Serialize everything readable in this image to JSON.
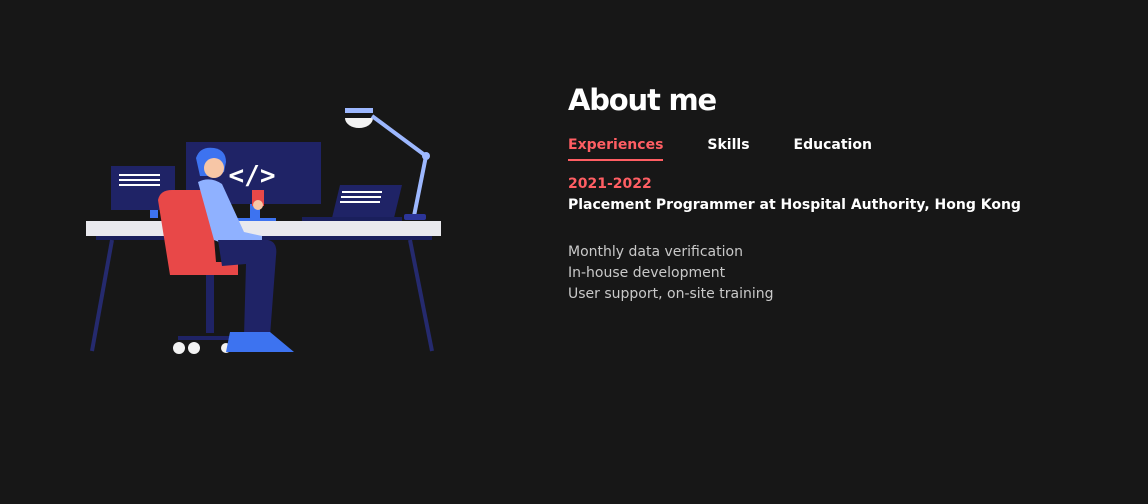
{
  "about": {
    "title": "About me",
    "tabs": [
      {
        "label": "Experiences",
        "active": true
      },
      {
        "label": "Skills",
        "active": false
      },
      {
        "label": "Education",
        "active": false
      }
    ],
    "experience": {
      "years": "2021-2022",
      "role": "Placement Programmer at Hospital Authority, Hong Kong",
      "duties": [
        "Monthly data verification",
        "In-house development",
        "User support, on-site training"
      ]
    }
  },
  "illustration": {
    "monitor_code_glyph": "</>"
  },
  "colors": {
    "background": "#171717",
    "accent": "#ff5e63",
    "text": "#ffffff",
    "muted_text": "#c9c9c9"
  }
}
